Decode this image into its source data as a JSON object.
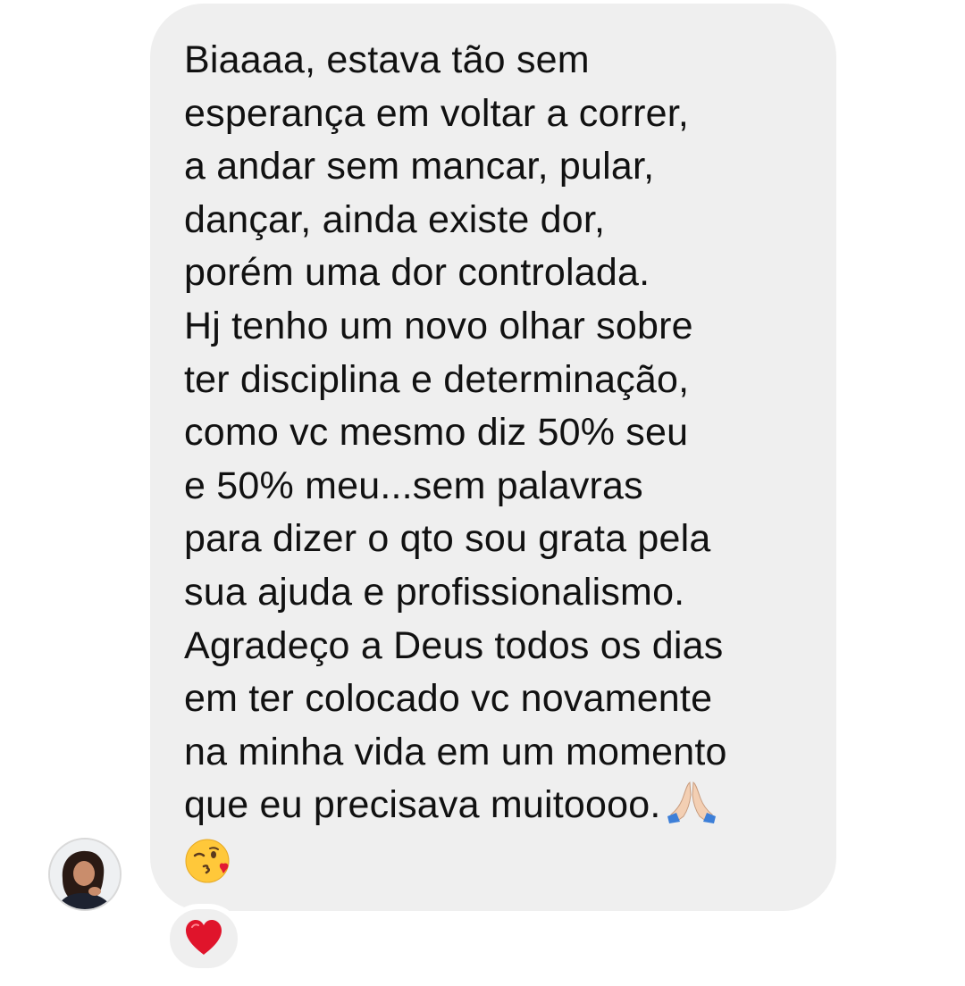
{
  "message": {
    "lines": [
      "Biaaaa, estava tão sem",
      "esperança em voltar a correr,",
      "a andar sem mancar, pular,",
      "dançar, ainda existe dor,",
      "porém uma dor controlada.",
      "Hj tenho um novo olhar sobre",
      "ter disciplina e determinação,",
      "como vc mesmo diz 50% seu",
      "e 50% meu...sem palavras",
      "para dizer o qto sou grata pela",
      "sua ajuda e profissionalismo.",
      "Agradeço a Deus todos os dias",
      "em ter colocado vc novamente",
      "na minha vida em um momento",
      "que eu precisava muitoooo."
    ],
    "emojis": [
      "praying-hands-icon",
      "kissing-wink-icon"
    ],
    "bubble_color": "#efefef",
    "text_color": "#111111"
  },
  "reaction": {
    "icon": "red-heart-icon",
    "color": "#e0142b"
  },
  "sender": {
    "avatar_icon": "profile-photo"
  }
}
